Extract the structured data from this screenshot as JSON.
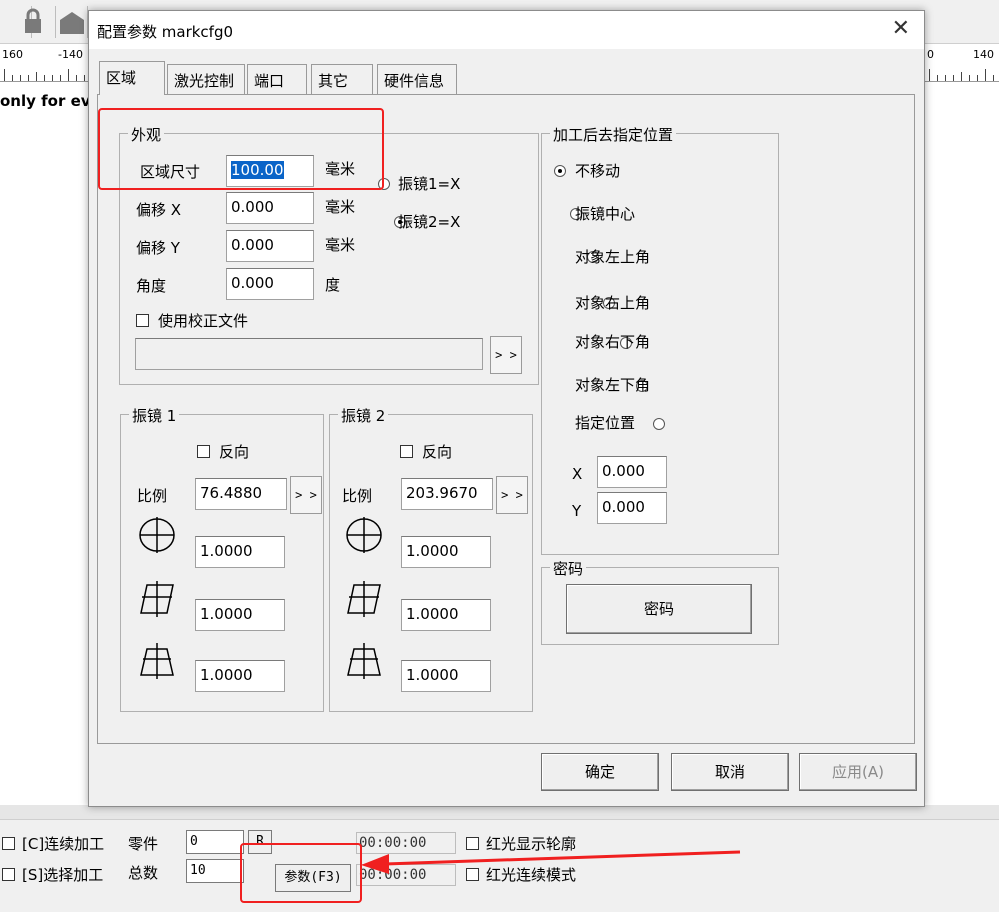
{
  "ruler": {
    "left_a": "160",
    "left_b": "-140",
    "right_a": "0",
    "right_b": "140"
  },
  "background_text": "only for ev",
  "dialog": {
    "title": "配置参数 markcfg0",
    "tabs": [
      "区域",
      "激光控制",
      "端口",
      "其它",
      "硬件信息"
    ],
    "appearance": {
      "legend": "外观",
      "rows": [
        {
          "label": "区域尺寸",
          "value": "100.00",
          "unit": "毫米"
        },
        {
          "label": "偏移 X",
          "value": "0.000",
          "unit": "毫米"
        },
        {
          "label": "偏移 Y",
          "value": "0.000",
          "unit": "毫米"
        },
        {
          "label": "角度",
          "value": "0.000",
          "unit": "度"
        }
      ],
      "galvo_options": [
        "振镜1=X",
        "振镜2=X"
      ],
      "selected_galvo": "振镜2=X",
      "use_correction_file": "使用校正文件",
      "browse_label": "> >"
    },
    "galvo1": {
      "legend": "振镜 1",
      "reverse_label": "反向",
      "scale_label": "比例",
      "scale_value": "76.4880",
      "scale_button": "> >",
      "values": [
        "1.0000",
        "1.0000",
        "1.0000"
      ]
    },
    "galvo2": {
      "legend": "振镜 2",
      "reverse_label": "反向",
      "scale_label": "比例",
      "scale_value": "203.9670",
      "scale_button": "> >",
      "values": [
        "1.0000",
        "1.0000",
        "1.0000"
      ]
    },
    "after_process": {
      "legend": "加工后去指定位置",
      "options": [
        "不移动",
        "振镜中心",
        "对象左上角",
        "对象右上角",
        "对象右下角",
        "对象左下角",
        "指定位置"
      ],
      "selected": "不移动",
      "x_label": "X",
      "x_value": "0.000",
      "y_label": "Y",
      "y_value": "0.000"
    },
    "password": {
      "legend": "密码",
      "button": "密码"
    },
    "footer": {
      "ok": "确定",
      "cancel": "取消",
      "apply": "应用(A)"
    }
  },
  "bottom_bar": {
    "continuous_label": "[C]连续加工",
    "select_label": "[S]选择加工",
    "parts_label": "零件",
    "parts_value": "0",
    "reset_button": "R",
    "total_label": "总数",
    "total_value": "10",
    "params_button": "参数(F3)",
    "time1": "00:00:00",
    "time2": "00:00:00",
    "red_outline_label": "红光显示轮廓",
    "red_continuous_label": "红光连续模式"
  },
  "colors": {
    "selection": "#0a64c8",
    "highlight": "#f02020"
  }
}
